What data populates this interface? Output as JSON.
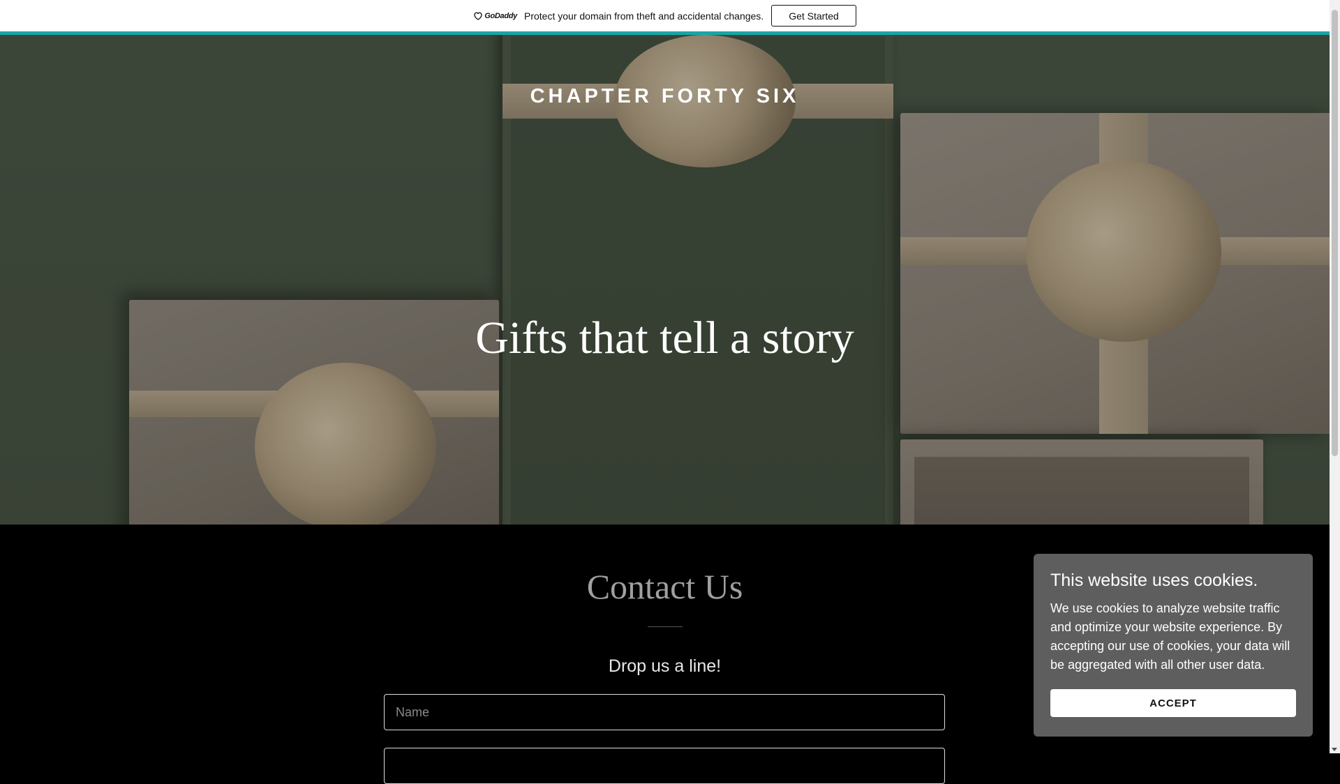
{
  "topbar": {
    "logo_text": "GoDaddy",
    "message": "Protect your domain from theft and accidental changes.",
    "cta_label": "Get Started",
    "accent_color": "#1aa6a6"
  },
  "hero": {
    "brand": "CHAPTER FORTY SIX",
    "headline": "Gifts that tell a story"
  },
  "contact": {
    "title": "Contact Us",
    "subtitle": "Drop us a line!",
    "name_placeholder": "Name",
    "email_placeholder": ""
  },
  "cookie": {
    "title": "This website uses cookies.",
    "text": "We use cookies to analyze website traffic and optimize your website experience. By accepting our use of cookies, your data will be aggregated with all other user data.",
    "accept_label": "ACCEPT"
  }
}
